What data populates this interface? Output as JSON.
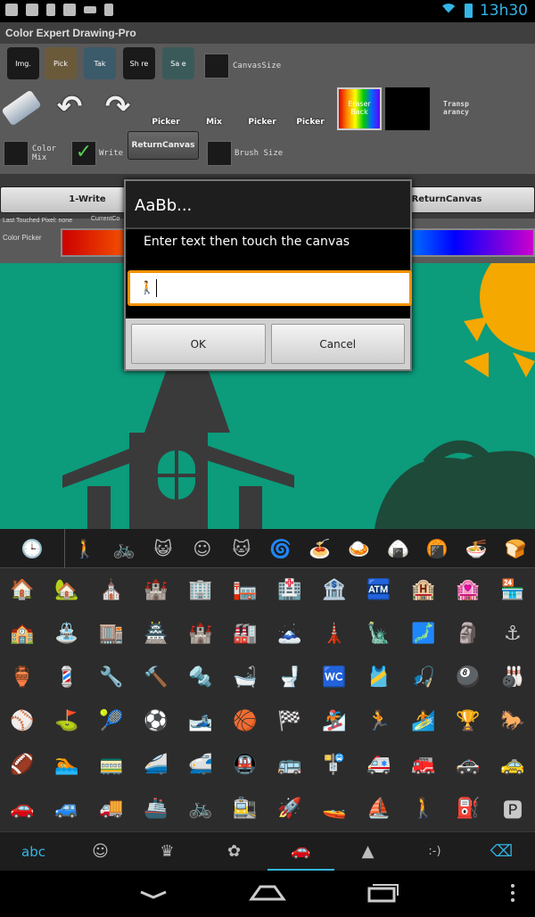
{
  "status": {
    "time": "13h30"
  },
  "app": {
    "title": "Color Expert Drawing-Pro",
    "top_buttons": [
      "Img.",
      "Pick",
      "Tak",
      "Sh re",
      "Sa e"
    ],
    "canvas_size_label": "CanvasSize",
    "tools": {
      "picker1": "Picker",
      "mix": "Mix",
      "picker2": "Picker",
      "picker3": "Picker",
      "eraser_back": "Eraser Back",
      "transparency": "Transp arancy"
    },
    "color_mix_label": "Color Mix",
    "write_label": "Write",
    "return_canvas": "ReturnCanvas",
    "brush_size_label": "Brush Size",
    "tab_write": "1-Write",
    "tab_return": "ReturnCanvas",
    "last_touched": "Last Touched Pixel: none",
    "current": "CurrentCo",
    "color_picker_label": "Color Picker"
  },
  "dialog": {
    "title": "AaBb...",
    "message": "Enter text then touch the canvas",
    "input_value": "🚶",
    "ok": "OK",
    "cancel": "Cancel"
  },
  "keyboard": {
    "tabs": [
      "🕒",
      "🚶",
      "🚲",
      "😺",
      "☺",
      "🐱",
      "🌀",
      "🍝",
      "🍛",
      "🍙",
      "🍘",
      "🍜",
      "🍞"
    ],
    "grid": [
      [
        "🏠",
        "🏡",
        "⛪",
        "🏰",
        "🏢",
        "🏣",
        "🏥",
        "🏦",
        "🏧",
        "🏨",
        "🏩",
        "🏪"
      ],
      [
        "🏫",
        "⛲",
        "🏬",
        "🏯",
        "🏰",
        "🏭",
        "🗻",
        "🗼",
        "🗽",
        "🗾",
        "🗿",
        "⚓"
      ],
      [
        "🏺",
        "💈",
        "🔧",
        "🔨",
        "🔩",
        "🛁",
        "🚽",
        "🚾",
        "🎽",
        "🎣",
        "🎱",
        "🎳"
      ],
      [
        "⚾",
        "⛳",
        "🎾",
        "⚽",
        "🎿",
        "🏀",
        "🏁",
        "🏂",
        "🏃",
        "🏄",
        "🏆",
        "🐎"
      ],
      [
        "🏈",
        "🏊",
        "🚃",
        "🚄",
        "🚅",
        "🚇",
        "🚌",
        "🚏",
        "🚑",
        "🚒",
        "🚓",
        "🚕"
      ],
      [
        "🚗",
        "🚙",
        "🚚",
        "🚢",
        "🚲",
        "🚉",
        "🚀",
        "🚤",
        "⛵",
        "🚶",
        "⛽",
        "🅿"
      ]
    ],
    "bottom": [
      "abc",
      "☺",
      "♛",
      "✿",
      "🚗",
      "▲",
      ":-)",
      "⌫"
    ]
  },
  "colors": {
    "canvas": "#0c9b7b",
    "accent": "#33b5e5",
    "input_border": "#f29100"
  }
}
